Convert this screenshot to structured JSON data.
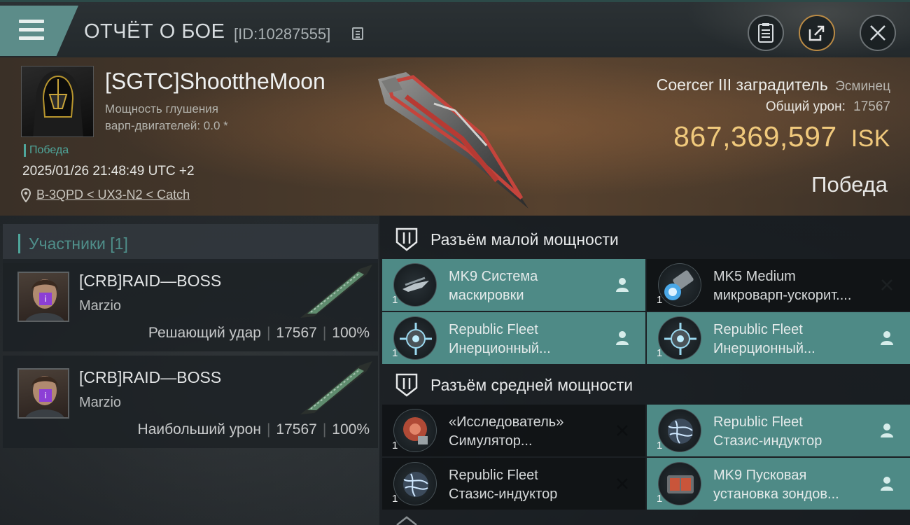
{
  "header": {
    "title": "ОТЧЁТ О БОЕ",
    "report_id": "[ID:10287555]"
  },
  "victim": {
    "name": "[SGTC]ShoottheMoon",
    "warp_label": "Мощность глушения",
    "warp_value": "варп-двигателей: 0.0 *",
    "tag": "Победа",
    "datetime": "2025/01/26 21:48:49 UTC +2",
    "location": "B-3QPD < UX3-N2 < Catch",
    "ship_name": "Coercer III заградитель",
    "ship_class": "Эсминец",
    "damage_label": "Общий урон:",
    "damage_value": "17567",
    "isk_value": "867,369,597",
    "isk_unit": "ISK",
    "result": "Победа"
  },
  "participants": {
    "header": "Участники [1]",
    "items": [
      {
        "name": "[CRB]RAID—BOSS",
        "corp": "Marzio",
        "role": "Решающий удар",
        "damage": "17567",
        "percent": "100%"
      },
      {
        "name": "[CRB]RAID—BOSS",
        "corp": "Marzio",
        "role": "Наибольший урон",
        "damage": "17567",
        "percent": "100%"
      }
    ]
  },
  "fittings": {
    "low": {
      "title": "Разъём малой мощности",
      "modules": [
        {
          "line1": "MK9 Система",
          "line2": "маскировки",
          "qty": "1",
          "state": "dropped"
        },
        {
          "line1": "MK5 Medium",
          "line2": "микроварп-ускорит....",
          "qty": "1",
          "state": "destroyed"
        },
        {
          "line1": "Republic Fleet",
          "line2": "Инерционный...",
          "qty": "1",
          "state": "dropped"
        },
        {
          "line1": "Republic Fleet",
          "line2": "Инерционный...",
          "qty": "1",
          "state": "dropped"
        }
      ]
    },
    "mid": {
      "title": "Разъём средней мощности",
      "modules": [
        {
          "line1": "«Исследователь»",
          "line2": "Симулятор...",
          "qty": "1",
          "state": "destroyed"
        },
        {
          "line1": "Republic Fleet",
          "line2": "Стазис-индуктор",
          "qty": "1",
          "state": "dropped"
        },
        {
          "line1": "Republic Fleet",
          "line2": "Стазис-индуктор",
          "qty": "1",
          "state": "destroyed"
        },
        {
          "line1": "MK9 Пусковая",
          "line2": "установка зондов...",
          "qty": "1",
          "state": "dropped"
        }
      ]
    }
  },
  "colors": {
    "accent": "#4fa79c",
    "module_dropped": "#4e8a86",
    "isk": "#f0c97c"
  }
}
